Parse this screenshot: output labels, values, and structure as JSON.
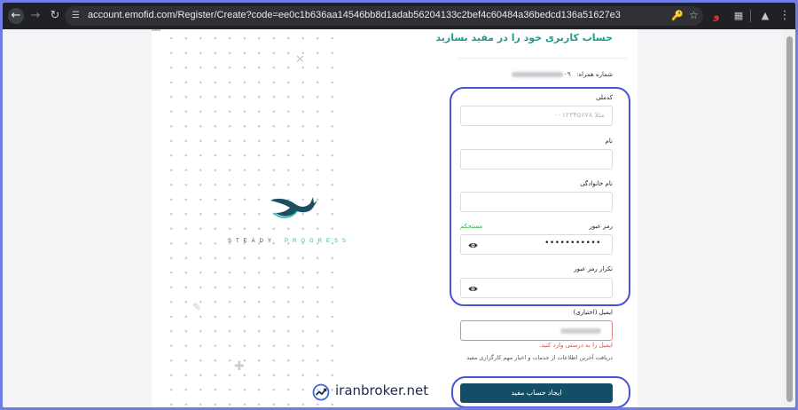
{
  "browser": {
    "url": "account.emofid.com/Register/Create?code=ee0c1b636aa14546bb8d1adab56204133c2bef4c60484a36bedcd136a51627e3",
    "icons": {
      "back": "arrow-left-icon",
      "forward": "arrow-right-icon",
      "reload": "reload-icon",
      "site_info": "tune-icon",
      "password": "key-icon",
      "bookmark": "star-icon",
      "extensions": "puzzle-icon",
      "menu": "kebab-menu-icon"
    }
  },
  "brand": {
    "tagline_left": "STEADY",
    "tagline_right": "PROGRESS",
    "colors": {
      "navy": "#1d4f63",
      "teal": "#2bb8ad"
    }
  },
  "form": {
    "title": "حساب کاربری خود را در مفید بسازید",
    "phone_label": "شماره همراه:",
    "phone_prefix": "۰۹",
    "national_code_label": "کدملی",
    "national_code_placeholder": "مثلا ۰۰۱۲۳۴۵۶۷۸",
    "first_name_label": "نام",
    "last_name_label": "نام خانوادگی",
    "password_label": "رمز عبور",
    "password_strength": "مستحکم",
    "password_value": "•••••••••••",
    "confirm_password_label": "تکرار رمز عبور",
    "email_label": "ایمیل (اختیاری)",
    "email_error": "ایمیل را به درستی وارد کنید.",
    "newsletter_text": "دریافت آخرین اطلاعات از خدمات و اخبار مهم کارگزاری مفید",
    "submit_label": "ایجاد حساب مفید",
    "colors": {
      "title": "#1f9c8e",
      "button": "#124e66",
      "error": "#d9534f",
      "strength": "#3bb54a"
    }
  },
  "watermark": {
    "text": "iranbroker.net"
  },
  "annotations": {
    "ring_color": "#4a52d4"
  }
}
